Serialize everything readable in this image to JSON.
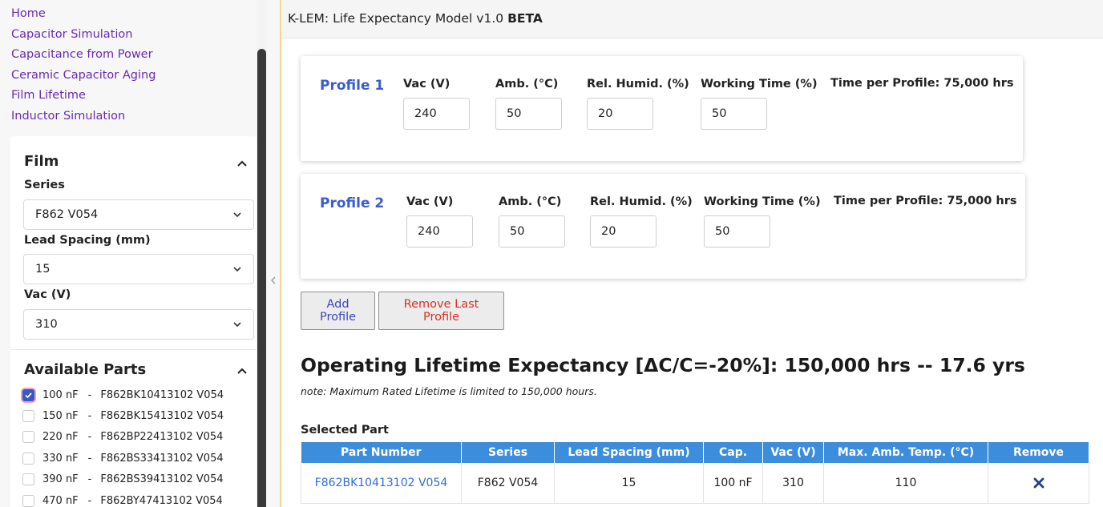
{
  "sidebar": {
    "links": [
      {
        "label": "Home"
      },
      {
        "label": "Capacitor Simulation"
      },
      {
        "label": "Capacitance from Power"
      },
      {
        "label": "Ceramic Capacitor Aging"
      },
      {
        "label": "Film Lifetime"
      },
      {
        "label": "Inductor Simulation"
      }
    ],
    "filter": {
      "title": "Film",
      "series_label": "Series",
      "series_value": "F862 V054",
      "lead_label": "Lead Spacing (mm)",
      "lead_value": "15",
      "vac_label": "Vac (V)",
      "vac_value": "310"
    },
    "available_parts": {
      "title": "Available Parts",
      "items": [
        {
          "cap": "100 nF",
          "sep": "-",
          "part": "F862BK10413102 V054",
          "checked": true
        },
        {
          "cap": "150 nF",
          "sep": "-",
          "part": "F862BK15413102 V054",
          "checked": false
        },
        {
          "cap": "220 nF",
          "sep": "-",
          "part": "F862BP22413102 V054",
          "checked": false
        },
        {
          "cap": "330 nF",
          "sep": "-",
          "part": "F862BS33413102 V054",
          "checked": false
        },
        {
          "cap": "390 nF",
          "sep": "-",
          "part": "F862BS39413102 V054",
          "checked": false
        },
        {
          "cap": "470 nF",
          "sep": "-",
          "part": "F862BY47413102 V054",
          "checked": false
        }
      ]
    }
  },
  "header": {
    "title": "K-LEM: Life Expectancy Model v1.0",
    "badge": "BETA"
  },
  "profiles": [
    {
      "name": "Profile 1",
      "vac_label": "Vac (V)",
      "vac": "240",
      "amb_label": "Amb. (°C)",
      "amb": "50",
      "hum_label": "Rel. Humid. (%)",
      "hum": "20",
      "work_label": "Working Time (%)",
      "work": "50",
      "time": "Time per Profile: 75,000 hrs"
    },
    {
      "name": "Profile 2",
      "vac_label": "Vac (V)",
      "vac": "240",
      "amb_label": "Amb. (°C)",
      "amb": "50",
      "hum_label": "Rel. Humid. (%)",
      "hum": "20",
      "work_label": "Working Time (%)",
      "work": "50",
      "time": "Time per Profile: 75,000 hrs"
    }
  ],
  "actions": {
    "add_profile": "Add Profile",
    "remove_last": "Remove Last Profile"
  },
  "results": {
    "heading": "Operating Lifetime Expectancy [ΔC/C=-20%]: 150,000 hrs -- 17.6 yrs",
    "note": "note: Maximum Rated Lifetime is limited to 150,000 hours."
  },
  "selected_part": {
    "label": "Selected Part",
    "columns": [
      "Part Number",
      "Series",
      "Lead Spacing (mm)",
      "Cap.",
      "Vac (V)",
      "Max. Amb. Temp. (°C)",
      "Remove"
    ],
    "row": {
      "part_number": "F862BK10413102 V054",
      "series": "F862 V054",
      "lead_spacing": "15",
      "cap": "100 nF",
      "vac": "310",
      "max_amb_temp": "110"
    }
  },
  "colors": {
    "link_purple": "#6a2bb0",
    "profile_blue": "#3b5bd0",
    "table_header": "#3c8ddb",
    "remove_red": "#d93025",
    "check_blue": "#3b56c9",
    "remove_icon": "#1f3f8a"
  },
  "icons": {
    "collapse": "chevron-left-icon",
    "section_toggle": "chevron-up-icon",
    "select_caret": "chevron-down-icon",
    "checkbox": "checkmark-icon",
    "remove": "close-icon"
  }
}
